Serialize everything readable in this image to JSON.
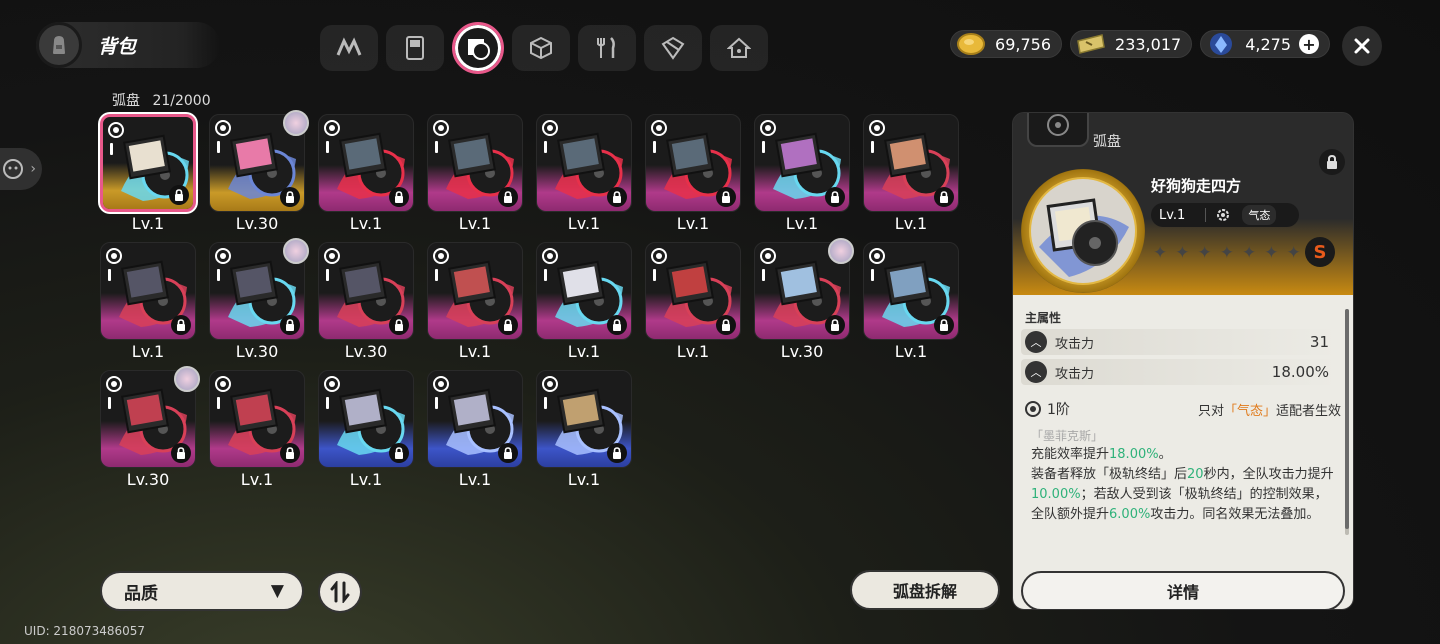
{
  "header": {
    "title": "背包",
    "tabs": [
      {
        "icon": "drive-icon"
      },
      {
        "icon": "gameboy-icon"
      },
      {
        "icon": "disc-icon",
        "active": true
      },
      {
        "icon": "box-icon"
      },
      {
        "icon": "fork-knife-icon"
      },
      {
        "icon": "package-icon"
      },
      {
        "icon": "home-icon"
      }
    ]
  },
  "currency": [
    {
      "icon": "gold-coin-icon",
      "value": "69,756"
    },
    {
      "icon": "ticket-icon",
      "value": "233,017"
    },
    {
      "icon": "crystal-icon",
      "value": "4,275"
    }
  ],
  "inventory": {
    "label": "弧盘",
    "count": "21/2000"
  },
  "cards": [
    {
      "level": "Lv.1",
      "quality": "gold",
      "selected": true,
      "has_avatar": false
    },
    {
      "level": "Lv.30",
      "quality": "gold",
      "selected": false,
      "has_avatar": true
    },
    {
      "level": "Lv.1",
      "quality": "pink",
      "selected": false,
      "has_avatar": false
    },
    {
      "level": "Lv.1",
      "quality": "pink",
      "selected": false,
      "has_avatar": false
    },
    {
      "level": "Lv.1",
      "quality": "pink",
      "selected": false,
      "has_avatar": false
    },
    {
      "level": "Lv.1",
      "quality": "pink",
      "selected": false,
      "has_avatar": false
    },
    {
      "level": "Lv.1",
      "quality": "pink",
      "selected": false,
      "has_avatar": false
    },
    {
      "level": "Lv.1",
      "quality": "pink",
      "selected": false,
      "has_avatar": false
    },
    {
      "level": "Lv.1",
      "quality": "pink",
      "selected": false,
      "has_avatar": false
    },
    {
      "level": "Lv.30",
      "quality": "pink",
      "selected": false,
      "has_avatar": true
    },
    {
      "level": "Lv.30",
      "quality": "pink",
      "selected": false,
      "has_avatar": false
    },
    {
      "level": "Lv.1",
      "quality": "pink",
      "selected": false,
      "has_avatar": false
    },
    {
      "level": "Lv.1",
      "quality": "pink",
      "selected": false,
      "has_avatar": false
    },
    {
      "level": "Lv.1",
      "quality": "pink",
      "selected": false,
      "has_avatar": false
    },
    {
      "level": "Lv.30",
      "quality": "pink",
      "selected": false,
      "has_avatar": true
    },
    {
      "level": "Lv.1",
      "quality": "pink",
      "selected": false,
      "has_avatar": false
    },
    {
      "level": "Lv.30",
      "quality": "pink",
      "selected": false,
      "has_avatar": true
    },
    {
      "level": "Lv.1",
      "quality": "pink",
      "selected": false,
      "has_avatar": false
    },
    {
      "level": "Lv.1",
      "quality": "blue",
      "selected": false,
      "has_avatar": false
    },
    {
      "level": "Lv.1",
      "quality": "blue",
      "selected": false,
      "has_avatar": false
    },
    {
      "level": "Lv.1",
      "quality": "blue",
      "selected": false,
      "has_avatar": false
    }
  ],
  "controls": {
    "quality_filter": "品质",
    "dismantle": "弧盘拆解"
  },
  "uid": "UID: 218073486057",
  "detail": {
    "type": "弧盘",
    "name": "好狗狗走四方",
    "level": "Lv.1",
    "attribute": "气态",
    "stars": 7,
    "badge": "S",
    "main_attr_title": "主属性",
    "stats": [
      {
        "name": "攻击力",
        "value": "31"
      },
      {
        "name": "攻击力",
        "value": "18.00%"
      }
    ],
    "tier": "1阶",
    "condition_prefix": "只对",
    "condition_highlight": "「气态」",
    "condition_suffix": "适配者生效",
    "set_name": "「墨菲克斯」",
    "effect_parts": [
      {
        "text": "充能效率提升",
        "hl": ""
      },
      {
        "text": "18.00%",
        "hl": "green"
      },
      {
        "text": "。",
        "hl": ""
      },
      {
        "text": "装备者释放「极轨终结」后",
        "hl": "br"
      },
      {
        "text": "20",
        "hl": "green"
      },
      {
        "text": "秒内，全队攻击力提升",
        "hl": ""
      },
      {
        "text": "10.00%",
        "hl": "green"
      },
      {
        "text": "；若敌人受到该「极轨终结」的控制效果，全队额外提升",
        "hl": ""
      },
      {
        "text": "6.00%",
        "hl": "green"
      },
      {
        "text": "攻击力。同名效果无法叠加。",
        "hl": ""
      }
    ],
    "detail_button": "详情"
  },
  "colors": {
    "accent_pink": "#e8588a",
    "quality_gold": "#c99a28",
    "quality_pink": "#b03a8a",
    "quality_blue": "#3d55c8",
    "highlight_green": "#2fb27a",
    "highlight_orange": "#e07a1b"
  }
}
